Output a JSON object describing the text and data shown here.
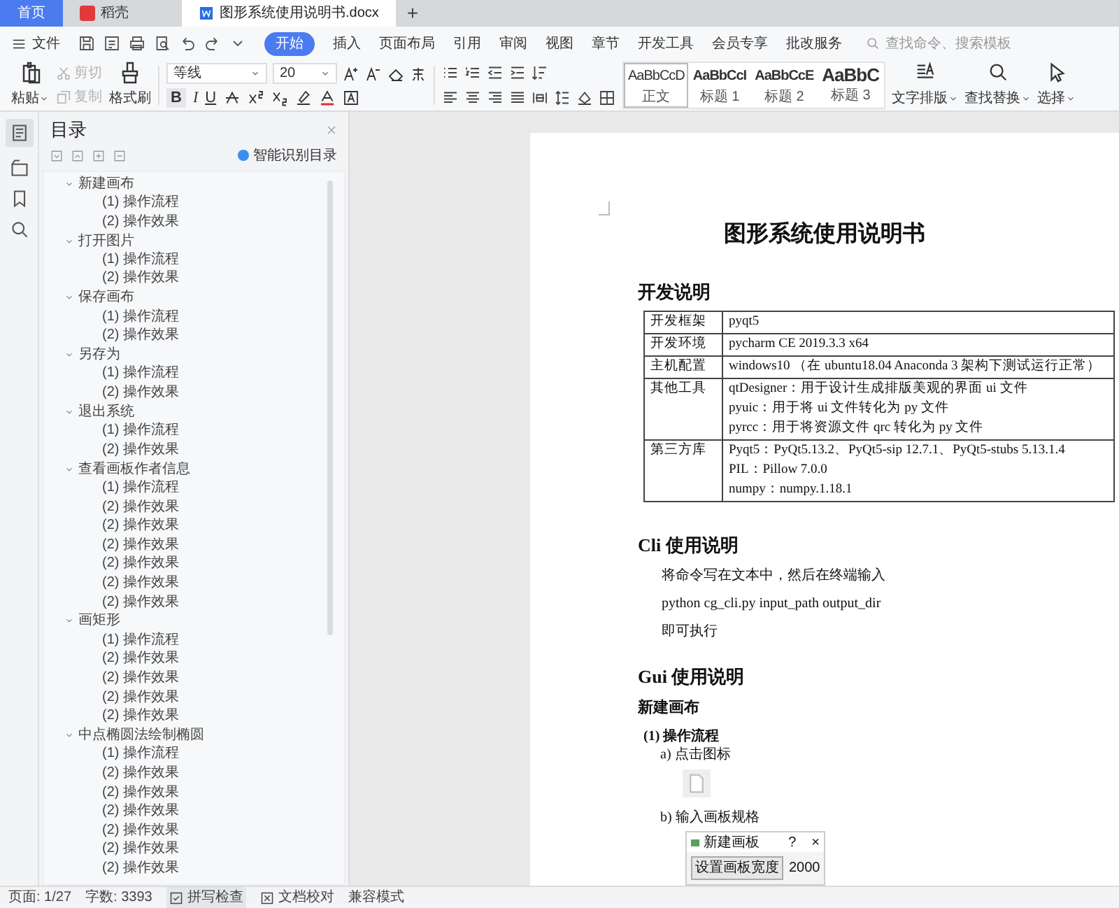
{
  "tabs": [
    {
      "label": "首页",
      "selected": false,
      "kind": "home"
    },
    {
      "label": "稻壳",
      "selected": false,
      "kind": "app"
    },
    {
      "label": "图形系统使用说明书.docx",
      "selected": true,
      "kind": "doc"
    }
  ],
  "new_tab": "+",
  "menu": {
    "file": "文件",
    "items": [
      {
        "label": "开始",
        "selected": true
      },
      {
        "label": "插入",
        "selected": false
      },
      {
        "label": "页面布局",
        "selected": false
      },
      {
        "label": "引用",
        "selected": false
      },
      {
        "label": "审阅",
        "selected": false
      },
      {
        "label": "视图",
        "selected": false
      },
      {
        "label": "章节",
        "selected": false
      },
      {
        "label": "开发工具",
        "selected": false
      },
      {
        "label": "会员专享",
        "selected": false
      },
      {
        "label": "批改服务",
        "selected": false
      }
    ],
    "search": {
      "placeholder": "查找命令、搜索模板"
    }
  },
  "ribbon": {
    "paste": "粘贴",
    "clipboard": [
      {
        "label": "剪切",
        "kind": "cut",
        "disabled": true
      },
      {
        "label": "复制",
        "kind": "copy",
        "disabled": true
      }
    ],
    "format_painter": "格式刷",
    "font": "等线",
    "size": "20",
    "format_glyphs": [
      "B",
      "I",
      "U"
    ],
    "styles": [
      {
        "sample": "AaBbCcD",
        "name": "正文",
        "selected": true,
        "kind": "normal"
      },
      {
        "sample": "AaBbCcI",
        "name": "标题 1",
        "selected": false,
        "kind": "h1"
      },
      {
        "sample": "AaBbCcE",
        "name": "标题 2",
        "selected": false,
        "kind": "h2"
      },
      {
        "sample": "AaBbC",
        "name": "标题 3",
        "selected": false,
        "kind": "h3"
      }
    ],
    "layout": "文字排版",
    "find_replace": "查找替换",
    "select": "选择"
  },
  "toc": {
    "title": "目录",
    "smart": "智能识别目录",
    "items": [
      {
        "label": "新建画布",
        "expanded": true,
        "children": [
          {
            "label": "(1) 操作流程"
          },
          {
            "label": "(2) 操作效果"
          }
        ]
      },
      {
        "label": "打开图片",
        "expanded": true,
        "children": [
          {
            "label": "(1) 操作流程"
          },
          {
            "label": "(2) 操作效果"
          }
        ]
      },
      {
        "label": "保存画布",
        "expanded": true,
        "children": [
          {
            "label": "(1) 操作流程"
          },
          {
            "label": "(2) 操作效果"
          }
        ]
      },
      {
        "label": "另存为",
        "expanded": true,
        "children": [
          {
            "label": "(1) 操作流程"
          },
          {
            "label": "(2) 操作效果"
          }
        ]
      },
      {
        "label": "退出系统",
        "expanded": true,
        "children": [
          {
            "label": "(1) 操作流程"
          },
          {
            "label": "(2) 操作效果"
          }
        ]
      },
      {
        "label": "查看画板作者信息",
        "expanded": true,
        "children": [
          {
            "label": "(1) 操作流程"
          },
          {
            "label": "(2) 操作效果"
          },
          {
            "label": "(2) 操作效果"
          },
          {
            "label": "(2) 操作效果"
          },
          {
            "label": "(2) 操作效果"
          },
          {
            "label": "(2) 操作效果"
          },
          {
            "label": "(2) 操作效果"
          }
        ]
      },
      {
        "label": "画矩形",
        "expanded": true,
        "children": [
          {
            "label": "(1) 操作流程"
          },
          {
            "label": "(2) 操作效果"
          },
          {
            "label": "(2) 操作效果"
          },
          {
            "label": "(2) 操作效果"
          },
          {
            "label": "(2) 操作效果"
          }
        ]
      },
      {
        "label": "中点椭圆法绘制椭圆",
        "expanded": true,
        "children": [
          {
            "label": "(1) 操作流程"
          },
          {
            "label": "(2) 操作效果"
          },
          {
            "label": "(2) 操作效果"
          },
          {
            "label": "(2) 操作效果"
          },
          {
            "label": "(2) 操作效果"
          },
          {
            "label": "(2) 操作效果"
          },
          {
            "label": "(2) 操作效果"
          }
        ]
      }
    ]
  },
  "document": {
    "title": "图形系统使用说明书",
    "blocks": [
      {
        "kind": "heading",
        "text": "开发说明"
      },
      {
        "kind": "table",
        "rows": [
          {
            "label": "开发框架",
            "lines": [
              "pyqt5"
            ]
          },
          {
            "label": "开发环境",
            "lines": [
              "pycharm CE 2019.3.3 x64"
            ]
          },
          {
            "label": "主机配置",
            "lines": [
              "windows10 （在 ubuntu18.04 Anaconda 3 架构下测试运行正常）"
            ]
          },
          {
            "label": "其他工具",
            "lines": [
              "qtDesigner：用于设计生成排版美观的界面 ui 文件",
              "pyuic：用于将 ui 文件转化为 py 文件",
              "pyrcc：用于将资源文件 qrc 转化为 py 文件"
            ]
          },
          {
            "label": "第三方库",
            "lines": [
              "Pyqt5：PyQt5.13.2、PyQt5-sip 12.7.1、PyQt5-stubs 5.13.1.4",
              "PIL：Pillow 7.0.0",
              "numpy：numpy.1.18.1"
            ]
          }
        ]
      },
      {
        "kind": "heading",
        "text": "Cli 使用说明"
      },
      {
        "kind": "paragraph",
        "text": "将命令写在文本中，然后在终端输入"
      },
      {
        "kind": "paragraph",
        "text": "python cg_cli.py input_path output_dir"
      },
      {
        "kind": "paragraph",
        "text": "即可执行"
      },
      {
        "kind": "heading",
        "text": "Gui 使用说明"
      },
      {
        "kind": "subheading",
        "text": "新建画布"
      },
      {
        "kind": "step",
        "text": "(1) 操作流程"
      },
      {
        "kind": "item",
        "text": "a) 点击图标"
      },
      {
        "kind": "file_image"
      },
      {
        "kind": "item",
        "text": "b) 输入画板规格"
      },
      {
        "kind": "dialog",
        "title": "新建画板",
        "help": "?",
        "close": "×",
        "button": "设置画板宽度",
        "value": "2000"
      }
    ]
  },
  "status_bar": {
    "page": "页面: 1/27",
    "words": "字数: 3393",
    "spell": "拼写检查",
    "proof": "文档校对",
    "compat": "兼容模式"
  }
}
